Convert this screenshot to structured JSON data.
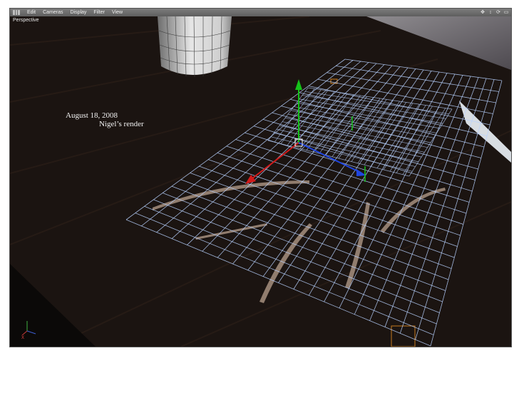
{
  "menu": {
    "items": [
      "Edit",
      "Cameras",
      "Display",
      "Filter",
      "View"
    ]
  },
  "nav_icons": [
    "move-view-icon",
    "zoom-view-icon",
    "rotate-view-icon",
    "maximize-view-icon"
  ],
  "viewport": {
    "label": "Perspective"
  },
  "captions": {
    "date": "August 18, 2008",
    "author": "Nigel’s render"
  },
  "colors": {
    "menubar": "#6e6e6e",
    "floor": "#1b1411",
    "grid": "#b8d2ff",
    "axis_x": "#d11a1a",
    "axis_y": "#15c21a",
    "axis_z": "#2046e0"
  }
}
